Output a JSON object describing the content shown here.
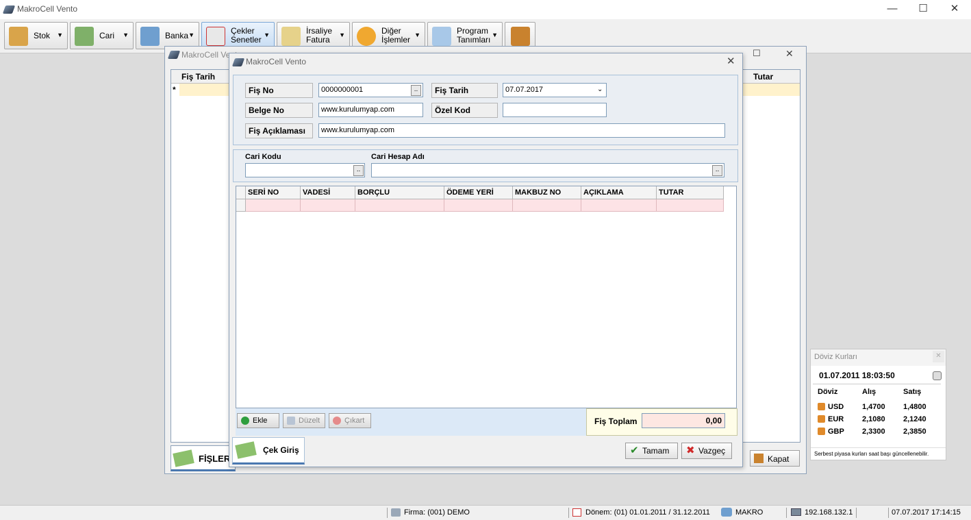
{
  "app": {
    "title": "MakroCell Vento"
  },
  "toolbar": {
    "stok": "Stok",
    "cari": "Cari",
    "banka": "Banka",
    "cekler_1": "Çekler",
    "cekler_2": "Senetler",
    "irsaliye_1": "İrsaliye",
    "irsaliye_2": "Fatura",
    "diger_1": "Diğer",
    "diger_2": "İşlemler",
    "program_1": "Program",
    "program_2": "Tanımları"
  },
  "background_window": {
    "title": "MakroCell Vento",
    "col_fis_tarih": "Fiş Tarih",
    "col_tutar": "Tutar",
    "row_marker": "*",
    "tab_label": "FİŞLER",
    "kapat": "Kapat"
  },
  "dialog": {
    "title": "MakroCell Vento",
    "fis_no_label": "Fiş No",
    "fis_no_value": "0000000001",
    "fis_tarih_label": "Fiş Tarih",
    "fis_tarih_value": "07.07.2017",
    "belge_no_label": "Belge No",
    "belge_no_value": "www.kurulumyap.com",
    "ozel_kod_label": "Özel Kod",
    "ozel_kod_value": "",
    "aciklama_label": "Fiş Açıklaması",
    "aciklama_value": "www.kurulumyap.com",
    "cari_kodu_label": "Cari Kodu",
    "cari_hesap_adi_label": "Cari Hesap Adı",
    "ellipsis": "..",
    "grid_columns": [
      "SERİ NO",
      "VADESİ",
      "BORÇLU",
      "ÖDEME YERİ",
      "MAKBUZ NO",
      "AÇIKLAMA",
      "TUTAR"
    ],
    "ekle": "Ekle",
    "duzelt": "Düzelt",
    "cikart": "Çıkart",
    "fis_toplam_label": "Fiş Toplam",
    "fis_toplam_value": "0,00",
    "tab_label": "Çek Giriş",
    "tamam": "Tamam",
    "vazgec": "Vazgeç"
  },
  "doviz": {
    "title": "Döviz Kurları",
    "datetime": "01.07.2011 18:03:50",
    "col_doviz": "Döviz",
    "col_alis": "Alış",
    "col_satis": "Satış",
    "rows": [
      {
        "code": "USD",
        "alis": "1,4700",
        "satis": "1,4800"
      },
      {
        "code": "EUR",
        "alis": "2,1080",
        "satis": "2,1240"
      },
      {
        "code": "GBP",
        "alis": "2,3300",
        "satis": "2,3850"
      }
    ],
    "note": "Serbest piyasa kurları saat başı güncellenebilir."
  },
  "statusbar": {
    "firma": "Firma: (001) DEMO",
    "donem": "Dönem: (01) 01.01.2011 / 31.12.2011",
    "user": "MAKRO",
    "ip": "192.168.132.1",
    "datetime": "07.07.2017 17:14:15"
  }
}
